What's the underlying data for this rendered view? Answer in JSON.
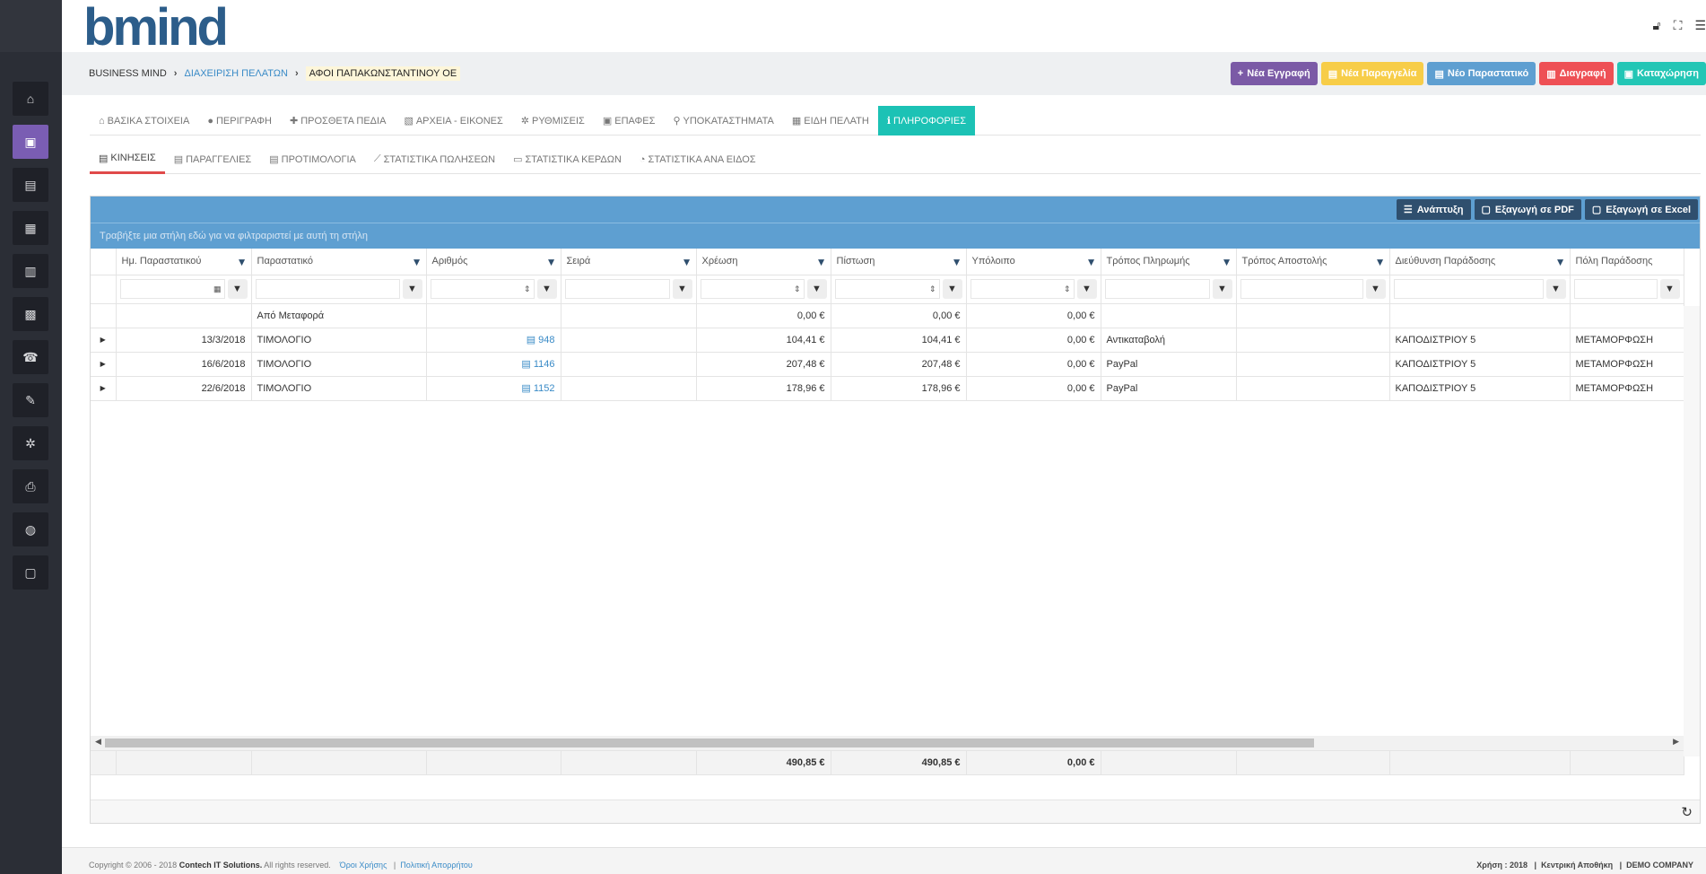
{
  "header": {
    "logo_text_a": "b",
    "logo_text_b": "mind",
    "icons": [
      "lock-open-icon",
      "fullscreen-icon",
      "menu-icon"
    ]
  },
  "breadcrumb": {
    "root": "BUSINESS MIND",
    "section": "ΔΙΑΧΕΙΡΙΣΗ ΠΕΛΑΤΩΝ",
    "current": "ΑΦΟΙ ΠΑΠΑΚΩΝΣΤΑΝΤΙΝΟΥ ΟΕ"
  },
  "actions": {
    "new_record": "Νέα Εγγραφή",
    "new_order": "Νέα Παραγγελία",
    "new_document": "Νέο Παραστατικό",
    "delete": "Διαγραφή",
    "save": "Καταχώρηση"
  },
  "tabs_main": [
    {
      "label": "ΒΑΣΙΚΑ ΣΤΟΙΧΕΙΑ",
      "icon": "home-icon"
    },
    {
      "label": "ΠΕΡΙΓΡΑΦΗ",
      "icon": "comment-icon"
    },
    {
      "label": "ΠΡΟΣΘΕΤΑ ΠΕΔΙΑ",
      "icon": "plus-icon"
    },
    {
      "label": "ΑΡΧΕΙΑ - ΕΙΚΟΝΕΣ",
      "icon": "image-icon"
    },
    {
      "label": "ΡΥΘΜΙΣΕΙΣ",
      "icon": "gear-icon"
    },
    {
      "label": "ΕΠΑΦΕΣ",
      "icon": "contact-icon"
    },
    {
      "label": "ΥΠΟΚΑΤΑΣΤΗΜΑΤΑ",
      "icon": "pin-icon"
    },
    {
      "label": "ΕΙΔΗ ΠΕΛΑΤΗ",
      "icon": "grid-icon"
    },
    {
      "label": "ΠΛΗΡΟΦΟΡΙΕΣ",
      "icon": "info-icon"
    }
  ],
  "tabs_sub": [
    {
      "label": "ΚΙΝΗΣΕΙΣ",
      "icon": "document-icon"
    },
    {
      "label": "ΠΑΡΑΓΓΕΛΙΕΣ",
      "icon": "document-icon"
    },
    {
      "label": "ΠΡΟΤΙΜΟΛΟΓΙΑ",
      "icon": "document-icon"
    },
    {
      "label": "ΣΤΑΤΙΣΤΙΚΑ ΠΩΛΗΣΕΩΝ",
      "icon": "line-chart-icon"
    },
    {
      "label": "ΣΤΑΤΙΣΤΙΚΑ ΚΕΡΔΩΝ",
      "icon": "money-icon"
    },
    {
      "label": "ΣΤΑΤΙΣΤΙΚΑ ΑΝΑ ΕΙΔΟΣ",
      "icon": "pie-chart-icon"
    }
  ],
  "grid": {
    "expand_label": "Ανάπτυξη",
    "export_pdf": "Εξαγωγή σε PDF",
    "export_excel": "Εξαγωγή σε Excel",
    "group_hint": "Τραβήξτε μια στήλη εδώ για να φιλτραριστεί με αυτή τη στήλη",
    "columns": [
      "Ημ. Παραστατικού",
      "Παραστατικό",
      "Αριθμός",
      "Σειρά",
      "Χρέωση",
      "Πίστωση",
      "Υπόλοιπο",
      "Τρόπος Πληρωμής",
      "Τρόπος Αποστολής",
      "Διεύθυνση Παράδοσης",
      "Πόλη Παράδοσης"
    ],
    "carry": {
      "label": "Από Μεταφορά",
      "debit": "0,00 €",
      "credit": "0,00 €",
      "balance": "0,00 €"
    },
    "rows": [
      {
        "date": "13/3/2018",
        "doc": "ΤΙΜΟΛΟΓΙΟ",
        "number": "948",
        "series": "",
        "debit": "104,41 €",
        "credit": "104,41 €",
        "balance": "0,00 €",
        "payment": "Αντικαταβολή",
        "shipping": "",
        "address": "ΚΑΠΟΔΙΣΤΡΙΟΥ 5",
        "city": "ΜΕΤΑΜΟΡΦΩΣΗ"
      },
      {
        "date": "16/6/2018",
        "doc": "ΤΙΜΟΛΟΓΙΟ",
        "number": "1146",
        "series": "",
        "debit": "207,48 €",
        "credit": "207,48 €",
        "balance": "0,00 €",
        "payment": "PayPal",
        "shipping": "",
        "address": "ΚΑΠΟΔΙΣΤΡΙΟΥ 5",
        "city": "ΜΕΤΑΜΟΡΦΩΣΗ"
      },
      {
        "date": "22/6/2018",
        "doc": "ΤΙΜΟΛΟΓΙΟ",
        "number": "1152",
        "series": "",
        "debit": "178,96 €",
        "credit": "178,96 €",
        "balance": "0,00 €",
        "payment": "PayPal",
        "shipping": "",
        "address": "ΚΑΠΟΔΙΣΤΡΙΟΥ 5",
        "city": "ΜΕΤΑΜΟΡΦΩΣΗ"
      }
    ],
    "totals": {
      "debit": "490,85 €",
      "credit": "490,85 €",
      "balance": "0,00 €"
    }
  },
  "footer": {
    "copyright": "Copyright © 2006 - 2018",
    "company": "Contech IT Solutions.",
    "rights": "All rights reserved.",
    "terms": "Όροι Χρήσης",
    "privacy": "Πολιτική Απορρήτου",
    "year": "Χρήση : 2018",
    "warehouse": "Κεντρική Αποθήκη",
    "org": "DEMO COMPANY"
  }
}
